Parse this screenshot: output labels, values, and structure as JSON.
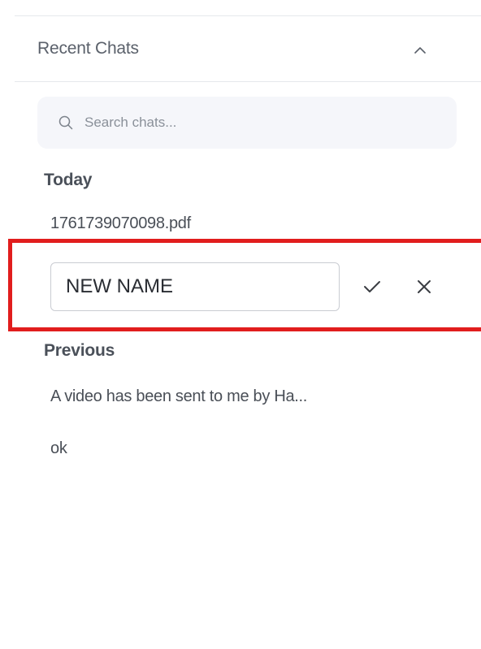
{
  "sidebar": {
    "section_title": "Recent Chats",
    "search": {
      "placeholder": "Search chats...",
      "value": ""
    },
    "groups": [
      {
        "label": "Today",
        "items": [
          {
            "label": "1761739070098.pdf"
          }
        ]
      },
      {
        "label": "Previous",
        "items": [
          {
            "label": "A video has been sent to me by Ha..."
          },
          {
            "label": "ok"
          }
        ]
      }
    ],
    "rename": {
      "value": "NEW NAME"
    }
  },
  "icons": {
    "collapse": "chevron-up-icon",
    "search": "search-icon",
    "confirm": "check-icon",
    "cancel": "close-icon"
  },
  "colors": {
    "highlight": "#e11d1d",
    "search_bg": "#f5f6fa",
    "divider": "#e6e8ec"
  }
}
